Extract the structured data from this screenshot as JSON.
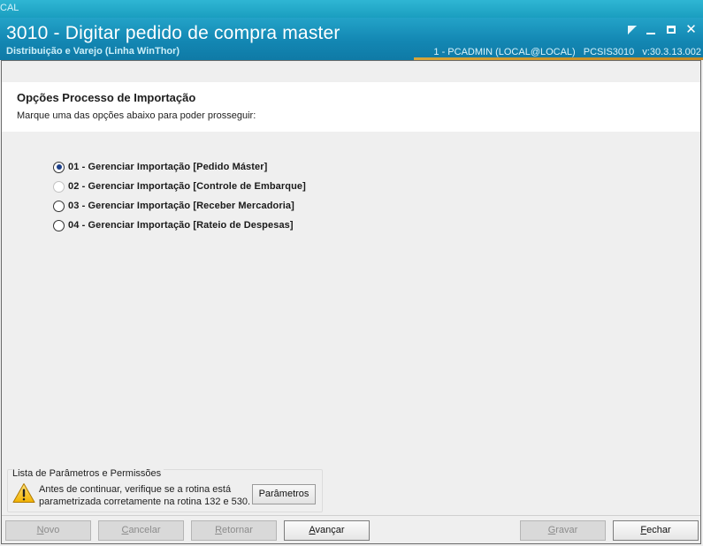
{
  "os_strip": {
    "text": "CAL"
  },
  "titlebar": {
    "title": "3010 - Digitar pedido de compra master",
    "subtitle": "Distribuição e Varejo (Linha WinThor)",
    "session_user": "1 - PCADMIN (LOCAL@LOCAL)",
    "session_module": "PCSIS3010",
    "session_version": "v:30.3.13.002",
    "accent_color": "#c9922a"
  },
  "header": {
    "title": "Opções Processo de Importação",
    "subtitle": "Marque uma das opções abaixo para poder prosseguir:"
  },
  "options": [
    {
      "label": "01 - Gerenciar Importação [Pedido Máster]",
      "checked": true
    },
    {
      "label": "02 - Gerenciar Importação [Controle de Embarque]",
      "checked": false
    },
    {
      "label": "03 - Gerenciar Importação [Receber Mercadoria]",
      "checked": false
    },
    {
      "label": "04 - Gerenciar Importação [Rateio de Despesas]",
      "checked": false
    }
  ],
  "params": {
    "group_title": "Lista de Parâmetros e Permissões",
    "warning_line1": "Antes de continuar, verifique se a rotina está",
    "warning_line2": "parametrizada corretamente na rotina 132 e 530.",
    "button_label": "Parâmetros",
    "warning_icon": "warning-triangle-icon"
  },
  "buttons": {
    "novo": {
      "first": "N",
      "rest": "ovo",
      "enabled": false
    },
    "cancelar": {
      "first": "C",
      "rest": "ancelar",
      "enabled": false
    },
    "retornar": {
      "first": "R",
      "rest": "etornar",
      "enabled": false
    },
    "avancar": {
      "first": "A",
      "rest": "vançar",
      "enabled": true
    },
    "gravar": {
      "first": "G",
      "rest": "ravar",
      "enabled": false
    },
    "fechar": {
      "first": "F",
      "rest": "echar",
      "enabled": true
    }
  }
}
